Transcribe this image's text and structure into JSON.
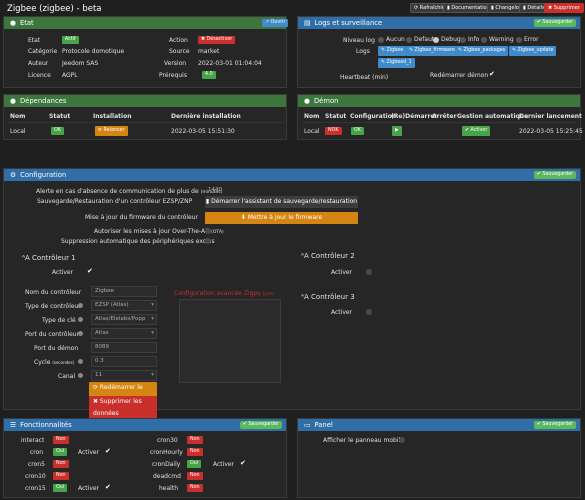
{
  "page": {
    "title": "Zigbee (zigbee) - beta"
  },
  "topbar": {
    "refresh": "⟳ Rafraîchir",
    "docs": "▮ Documentation",
    "changelog": "▮ Changelog",
    "details": "▮ Détails",
    "delete": "✖ Supprimer"
  },
  "etat": {
    "title": "Etat",
    "open": "↗ Ouvrir",
    "labels": {
      "etat": "Etat",
      "categorie": "Catégorie",
      "auteur": "Auteur",
      "licence": "Licence",
      "action": "Action",
      "source": "Source",
      "version": "Version",
      "prerequis": "Prérequis"
    },
    "values": {
      "etat": "Actif",
      "categorie": "Protocole domotique",
      "auteur": "Jeedom SAS",
      "licence": "AGPL",
      "action": "✖ Désactiver",
      "source": "market",
      "version": "2022-03-01 01:04:04",
      "prerequis": "4.0"
    }
  },
  "logs": {
    "title": "Logs et surveillance",
    "save": "✔ Sauvegarder",
    "niveau_label": "Niveau log",
    "levels": [
      "Aucun",
      "Defaut",
      "Debug",
      "Info",
      "Warning",
      "Error"
    ],
    "logs_label": "Logs",
    "files": [
      "✎ Zigbee",
      "✎ Zigbee_firmware",
      "✎ Zigbee_packages",
      "✎ Zigbee_update",
      "✎ Zigbeed_1"
    ],
    "heartbeat": "Heartbeat (min)",
    "restart": "Redémarrer démon"
  },
  "deps": {
    "title": "Dépendances",
    "headers": [
      "Nom",
      "Statut",
      "Installation",
      "Dernière installation"
    ],
    "row": {
      "nom": "Local",
      "statut": "OK",
      "install": "⟳ Relancer",
      "date": "2022-03-05 15:51:30"
    }
  },
  "demon": {
    "title": "Démon",
    "headers": [
      "Nom",
      "Statut",
      "Configuration",
      "(Re)Démarrer",
      "Arrêter",
      "Gestion automatique",
      "Dernier lancement"
    ],
    "row": {
      "nom": "Local",
      "statut": "NOK",
      "config": "OK",
      "start": "▶",
      "auto": "✔ Activer",
      "date": "2022-03-05 15:25:45"
    }
  },
  "config": {
    "title": "Configuration",
    "save": "✔ Sauvegarder",
    "alert_label": "Alerte en cas d'absence de communication de plus de",
    "alert_unit": "(minutes)",
    "alert_value": "1440",
    "backup_label": "Sauvegarde/Restauration d'un contrôleur EZSP/ZNP",
    "backup_btn": "▮ Démarrer l'assistant de sauvegarde/restauration",
    "firmware_label": "Mise à jour du firmware du contrôleur",
    "firmware_btn": "⬇ Mettre à jour le firmware",
    "ota_label": "Autoriser les mises à jour Over-The-Air",
    "ota_unit": "(OTA)",
    "excl_label": "Suppression automatique des périphériques exclus",
    "c1": {
      "title": "Contrôleur 1",
      "activer": "Activer",
      "nom_label": "Nom du contrôleur",
      "nom": "Zigbee",
      "type_label": "Type de contrôleur",
      "type": "EZSP (Atlas)",
      "cle_label": "Type de clé",
      "cle": "Atlas/Elelabs/Popp",
      "port_label": "Port du contrôleur",
      "port": "Atlas",
      "demon_port_label": "Port du démon",
      "demon_port": "8089",
      "cycle_label": "Cycle",
      "cycle_unit": "(secondes)",
      "cycle": "0.3",
      "canal_label": "Canal",
      "canal": "11",
      "restart_btn": "⟳ Redémarrer le démon",
      "del_btn": "✖ Supprimer les données",
      "adv_title": "Configuration avancée Zigpy",
      "adv_unit": "(json)"
    },
    "c2": {
      "title": "Contrôleur 2",
      "activer": "Activer"
    },
    "c3": {
      "title": "Contrôleur 3",
      "activer": "Activer"
    }
  },
  "fonctions": {
    "title": "Fonctionnalités",
    "save": "✔ Sauvegarder",
    "activer": "Activer",
    "left": [
      {
        "name": "interact",
        "state": "Non"
      },
      {
        "name": "cron",
        "state": "Oui"
      },
      {
        "name": "cron5",
        "state": "Non"
      },
      {
        "name": "cron10",
        "state": "Non"
      },
      {
        "name": "cron15",
        "state": "Oui"
      }
    ],
    "right": [
      {
        "name": "cron30",
        "state": "Non"
      },
      {
        "name": "cronHourly",
        "state": "Non"
      },
      {
        "name": "cronDaily",
        "state": "Oui"
      },
      {
        "name": "deadcmd",
        "state": "Non"
      },
      {
        "name": "health",
        "state": "Non"
      }
    ]
  },
  "panel": {
    "title": "Panel",
    "save": "✔ Sauvegarder",
    "mobile": "Afficher le panneau mobile"
  },
  "colors": {
    "green": "#3c763d",
    "blue": "#2f6ea6",
    "ok": "#47a447",
    "nok": "#c9302c",
    "orange": "#d58512"
  }
}
